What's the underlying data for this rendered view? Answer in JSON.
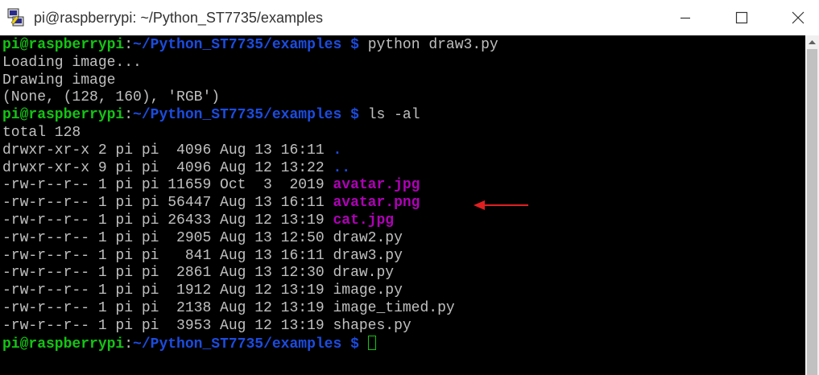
{
  "window": {
    "title": "pi@raspberrypi: ~/Python_ST7735/examples",
    "icons": {
      "app": "putty-icon",
      "minimize": "minimize-icon",
      "maximize": "maximize-icon",
      "close": "close-icon"
    }
  },
  "colors": {
    "prompt_user": "#13c513",
    "prompt_path": "#1c4ce0",
    "image_files": "#b000b8",
    "directories": "#1c4ce0",
    "text": "#c0c0c0",
    "annotation_arrow": "#e02020"
  },
  "prompt": {
    "user": "pi@raspberrypi",
    "colon": ":",
    "path": "~/Python_ST7735/examples $"
  },
  "commands": {
    "cmd1": " python draw3.py",
    "cmd2": " ls -al"
  },
  "output": {
    "l1": "Loading image...",
    "l2": "Drawing image",
    "l3": "(None, (128, 160), 'RGB')",
    "total": "total 128"
  },
  "listing": [
    {
      "meta": "drwxr-xr-x 2 pi pi  4096 Aug 13 16:11 ",
      "name": ".",
      "kind": "dir"
    },
    {
      "meta": "drwxr-xr-x 9 pi pi  4096 Aug 12 13:22 ",
      "name": "..",
      "kind": "dir"
    },
    {
      "meta": "-rw-r--r-- 1 pi pi 11659 Oct  3  2019 ",
      "name": "avatar.jpg",
      "kind": "image"
    },
    {
      "meta": "-rw-r--r-- 1 pi pi 56447 Aug 13 16:11 ",
      "name": "avatar.png",
      "kind": "image"
    },
    {
      "meta": "-rw-r--r-- 1 pi pi 26433 Aug 12 13:19 ",
      "name": "cat.jpg",
      "kind": "image"
    },
    {
      "meta": "-rw-r--r-- 1 pi pi  2905 Aug 13 12:50 ",
      "name": "draw2.py",
      "kind": "file"
    },
    {
      "meta": "-rw-r--r-- 1 pi pi   841 Aug 13 16:11 ",
      "name": "draw3.py",
      "kind": "file"
    },
    {
      "meta": "-rw-r--r-- 1 pi pi  2861 Aug 13 12:30 ",
      "name": "draw.py",
      "kind": "file"
    },
    {
      "meta": "-rw-r--r-- 1 pi pi  1912 Aug 12 13:19 ",
      "name": "image.py",
      "kind": "file"
    },
    {
      "meta": "-rw-r--r-- 1 pi pi  2138 Aug 12 13:19 ",
      "name": "image_timed.py",
      "kind": "file"
    },
    {
      "meta": "-rw-r--r-- 1 pi pi  3953 Aug 12 13:19 ",
      "name": "shapes.py",
      "kind": "file"
    }
  ]
}
